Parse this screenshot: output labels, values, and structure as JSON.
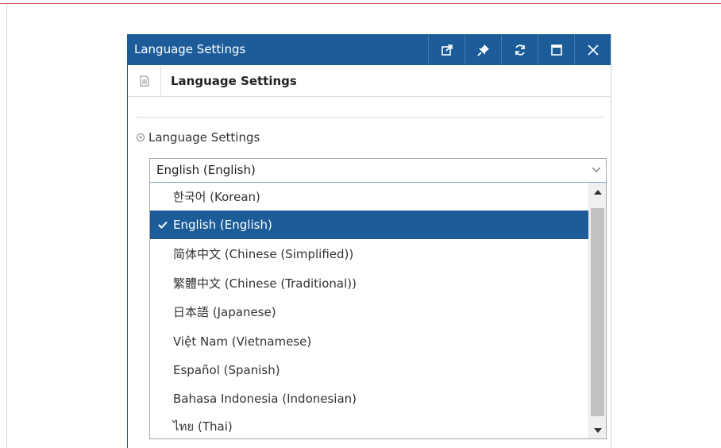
{
  "window": {
    "title": "Language Settings",
    "buttons": [
      "popout-icon",
      "pin-icon",
      "refresh-icon",
      "maximize-icon",
      "close-icon"
    ]
  },
  "subheader": {
    "title": "Language Settings"
  },
  "section": {
    "label": "Language Settings"
  },
  "language_select": {
    "value": "English (English)",
    "options": [
      "한국어 (Korean)",
      "English (English)",
      "简体中文 (Chinese (Simplified))",
      "繁體中文 (Chinese (Traditional))",
      "日本語 (Japanese)",
      "Việt Nam (Vietnamese)",
      "Español (Spanish)",
      "Bahasa Indonesia (Indonesian)",
      "ไทย (Thai)"
    ],
    "selected_index": 1
  },
  "colors": {
    "titlebar": "#1c5d99",
    "selected_option": "#1c5d99",
    "accent_line": "#c9485b"
  }
}
